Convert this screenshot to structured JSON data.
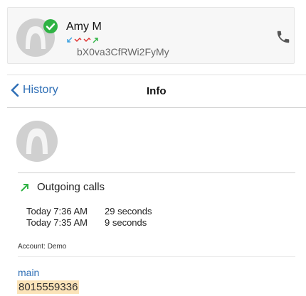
{
  "contact": {
    "name": "Amy M",
    "id": "bX0va3CfRWi2FyMy",
    "presence_color": "#2fb344",
    "recent_calls": [
      "incoming",
      "missed",
      "missed",
      "outgoing"
    ]
  },
  "nav": {
    "back_label": "History",
    "title": "Info"
  },
  "call_group": {
    "type_label": "Outgoing calls",
    "entries": [
      {
        "time": "Today 7:36 AM",
        "duration": "29 seconds"
      },
      {
        "time": "Today 7:35 AM",
        "duration": "9 seconds"
      }
    ]
  },
  "account": {
    "text": "Account: Demo"
  },
  "number": {
    "label": "main",
    "value": "8015559336"
  },
  "colors": {
    "accent": "#2f6fb6",
    "outgoing": "#2fb344",
    "missed": "#e0302e",
    "incoming": "#3aa0e0",
    "highlight": "#fbe3b8"
  }
}
